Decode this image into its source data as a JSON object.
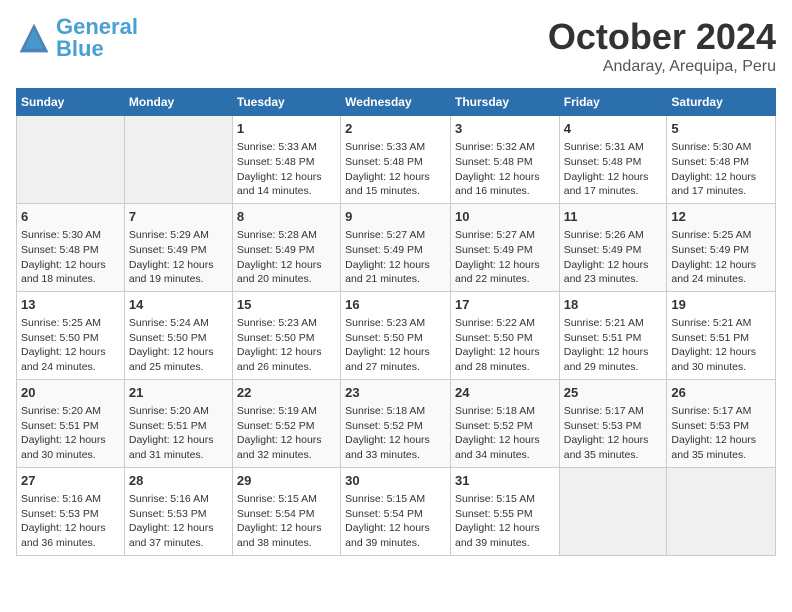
{
  "header": {
    "logo_text1": "General",
    "logo_text2": "Blue",
    "month": "October 2024",
    "location": "Andaray, Arequipa, Peru"
  },
  "weekdays": [
    "Sunday",
    "Monday",
    "Tuesday",
    "Wednesday",
    "Thursday",
    "Friday",
    "Saturday"
  ],
  "weeks": [
    [
      {
        "day": "",
        "sunrise": "",
        "sunset": "",
        "daylight": "",
        "empty": true
      },
      {
        "day": "",
        "sunrise": "",
        "sunset": "",
        "daylight": "",
        "empty": true
      },
      {
        "day": "1",
        "sunrise": "Sunrise: 5:33 AM",
        "sunset": "Sunset: 5:48 PM",
        "daylight": "Daylight: 12 hours and 14 minutes."
      },
      {
        "day": "2",
        "sunrise": "Sunrise: 5:33 AM",
        "sunset": "Sunset: 5:48 PM",
        "daylight": "Daylight: 12 hours and 15 minutes."
      },
      {
        "day": "3",
        "sunrise": "Sunrise: 5:32 AM",
        "sunset": "Sunset: 5:48 PM",
        "daylight": "Daylight: 12 hours and 16 minutes."
      },
      {
        "day": "4",
        "sunrise": "Sunrise: 5:31 AM",
        "sunset": "Sunset: 5:48 PM",
        "daylight": "Daylight: 12 hours and 17 minutes."
      },
      {
        "day": "5",
        "sunrise": "Sunrise: 5:30 AM",
        "sunset": "Sunset: 5:48 PM",
        "daylight": "Daylight: 12 hours and 17 minutes."
      }
    ],
    [
      {
        "day": "6",
        "sunrise": "Sunrise: 5:30 AM",
        "sunset": "Sunset: 5:48 PM",
        "daylight": "Daylight: 12 hours and 18 minutes."
      },
      {
        "day": "7",
        "sunrise": "Sunrise: 5:29 AM",
        "sunset": "Sunset: 5:49 PM",
        "daylight": "Daylight: 12 hours and 19 minutes."
      },
      {
        "day": "8",
        "sunrise": "Sunrise: 5:28 AM",
        "sunset": "Sunset: 5:49 PM",
        "daylight": "Daylight: 12 hours and 20 minutes."
      },
      {
        "day": "9",
        "sunrise": "Sunrise: 5:27 AM",
        "sunset": "Sunset: 5:49 PM",
        "daylight": "Daylight: 12 hours and 21 minutes."
      },
      {
        "day": "10",
        "sunrise": "Sunrise: 5:27 AM",
        "sunset": "Sunset: 5:49 PM",
        "daylight": "Daylight: 12 hours and 22 minutes."
      },
      {
        "day": "11",
        "sunrise": "Sunrise: 5:26 AM",
        "sunset": "Sunset: 5:49 PM",
        "daylight": "Daylight: 12 hours and 23 minutes."
      },
      {
        "day": "12",
        "sunrise": "Sunrise: 5:25 AM",
        "sunset": "Sunset: 5:49 PM",
        "daylight": "Daylight: 12 hours and 24 minutes."
      }
    ],
    [
      {
        "day": "13",
        "sunrise": "Sunrise: 5:25 AM",
        "sunset": "Sunset: 5:50 PM",
        "daylight": "Daylight: 12 hours and 24 minutes."
      },
      {
        "day": "14",
        "sunrise": "Sunrise: 5:24 AM",
        "sunset": "Sunset: 5:50 PM",
        "daylight": "Daylight: 12 hours and 25 minutes."
      },
      {
        "day": "15",
        "sunrise": "Sunrise: 5:23 AM",
        "sunset": "Sunset: 5:50 PM",
        "daylight": "Daylight: 12 hours and 26 minutes."
      },
      {
        "day": "16",
        "sunrise": "Sunrise: 5:23 AM",
        "sunset": "Sunset: 5:50 PM",
        "daylight": "Daylight: 12 hours and 27 minutes."
      },
      {
        "day": "17",
        "sunrise": "Sunrise: 5:22 AM",
        "sunset": "Sunset: 5:50 PM",
        "daylight": "Daylight: 12 hours and 28 minutes."
      },
      {
        "day": "18",
        "sunrise": "Sunrise: 5:21 AM",
        "sunset": "Sunset: 5:51 PM",
        "daylight": "Daylight: 12 hours and 29 minutes."
      },
      {
        "day": "19",
        "sunrise": "Sunrise: 5:21 AM",
        "sunset": "Sunset: 5:51 PM",
        "daylight": "Daylight: 12 hours and 30 minutes."
      }
    ],
    [
      {
        "day": "20",
        "sunrise": "Sunrise: 5:20 AM",
        "sunset": "Sunset: 5:51 PM",
        "daylight": "Daylight: 12 hours and 30 minutes."
      },
      {
        "day": "21",
        "sunrise": "Sunrise: 5:20 AM",
        "sunset": "Sunset: 5:51 PM",
        "daylight": "Daylight: 12 hours and 31 minutes."
      },
      {
        "day": "22",
        "sunrise": "Sunrise: 5:19 AM",
        "sunset": "Sunset: 5:52 PM",
        "daylight": "Daylight: 12 hours and 32 minutes."
      },
      {
        "day": "23",
        "sunrise": "Sunrise: 5:18 AM",
        "sunset": "Sunset: 5:52 PM",
        "daylight": "Daylight: 12 hours and 33 minutes."
      },
      {
        "day": "24",
        "sunrise": "Sunrise: 5:18 AM",
        "sunset": "Sunset: 5:52 PM",
        "daylight": "Daylight: 12 hours and 34 minutes."
      },
      {
        "day": "25",
        "sunrise": "Sunrise: 5:17 AM",
        "sunset": "Sunset: 5:53 PM",
        "daylight": "Daylight: 12 hours and 35 minutes."
      },
      {
        "day": "26",
        "sunrise": "Sunrise: 5:17 AM",
        "sunset": "Sunset: 5:53 PM",
        "daylight": "Daylight: 12 hours and 35 minutes."
      }
    ],
    [
      {
        "day": "27",
        "sunrise": "Sunrise: 5:16 AM",
        "sunset": "Sunset: 5:53 PM",
        "daylight": "Daylight: 12 hours and 36 minutes."
      },
      {
        "day": "28",
        "sunrise": "Sunrise: 5:16 AM",
        "sunset": "Sunset: 5:53 PM",
        "daylight": "Daylight: 12 hours and 37 minutes."
      },
      {
        "day": "29",
        "sunrise": "Sunrise: 5:15 AM",
        "sunset": "Sunset: 5:54 PM",
        "daylight": "Daylight: 12 hours and 38 minutes."
      },
      {
        "day": "30",
        "sunrise": "Sunrise: 5:15 AM",
        "sunset": "Sunset: 5:54 PM",
        "daylight": "Daylight: 12 hours and 39 minutes."
      },
      {
        "day": "31",
        "sunrise": "Sunrise: 5:15 AM",
        "sunset": "Sunset: 5:55 PM",
        "daylight": "Daylight: 12 hours and 39 minutes."
      },
      {
        "day": "",
        "sunrise": "",
        "sunset": "",
        "daylight": "",
        "empty": true
      },
      {
        "day": "",
        "sunrise": "",
        "sunset": "",
        "daylight": "",
        "empty": true
      }
    ]
  ]
}
